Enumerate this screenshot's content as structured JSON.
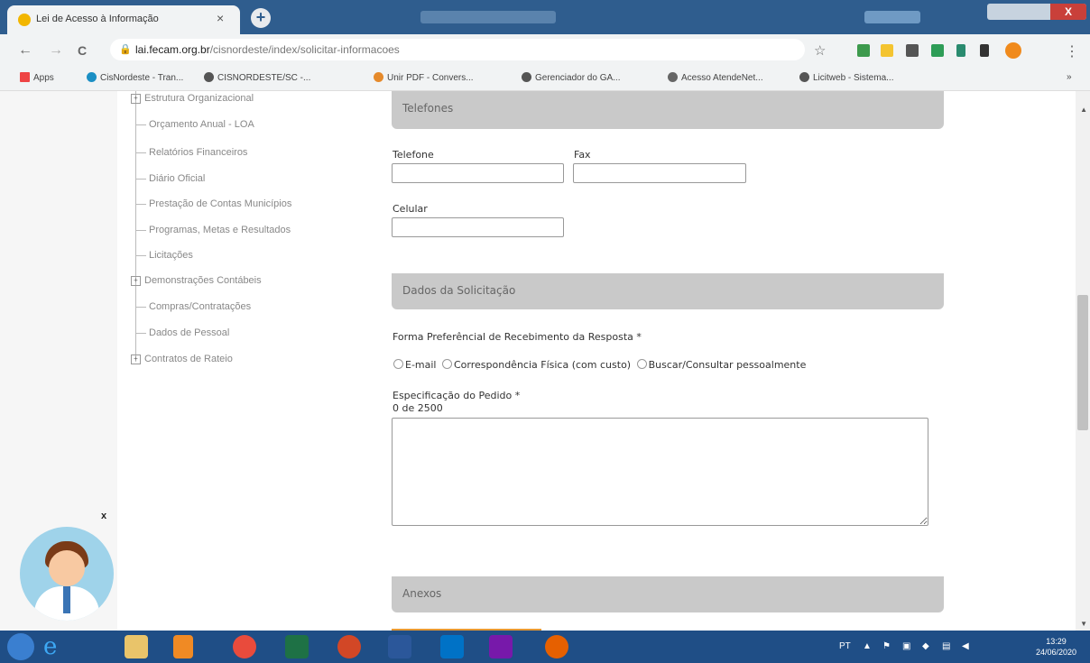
{
  "browser": {
    "tab_title": "Lei de Acesso à Informação",
    "tab_close": "×",
    "new_tab": "+",
    "url_host": "lai.fecam.org.br",
    "url_path": "/cisnordeste/index/solicitar-informacoes",
    "nav": {
      "back": "←",
      "forward": "→",
      "reload": "C",
      "star": "☆",
      "menu": "⋮"
    },
    "bookmarks": [
      "Apps",
      "CisNordeste - Tran...",
      "CISNORDESTE/SC -...",
      "Unir PDF - Convers...",
      "Gerenciador do GA...",
      "Acesso AtendeNet...",
      "Licitweb - Sistema..."
    ],
    "bookmarks_more": "»",
    "window_close": "X"
  },
  "tree": {
    "items": [
      {
        "label": "Estrutura Organizacional",
        "expandable": true
      },
      {
        "label": "Orçamento Anual - LOA",
        "expandable": false
      },
      {
        "label": "Relatórios Financeiros",
        "expandable": false
      },
      {
        "label": "Diário Oficial",
        "expandable": false
      },
      {
        "label": "Prestação de Contas Municípios",
        "expandable": false
      },
      {
        "label": "Programas, Metas e Resultados",
        "expandable": false
      },
      {
        "label": "Licitações",
        "expandable": false
      },
      {
        "label": "Demonstrações Contábeis",
        "expandable": true
      },
      {
        "label": "Compras/Contratações",
        "expandable": false
      },
      {
        "label": "Dados de Pessoal",
        "expandable": false
      },
      {
        "label": "Contratos de Rateio",
        "expandable": true
      }
    ]
  },
  "form": {
    "telefones_header": "Telefones",
    "telefone_label": "Telefone",
    "fax_label": "Fax",
    "celular_label": "Celular",
    "dados_header": "Dados da Solicitação",
    "forma_label": "Forma Preferêncial de Recebimento da Resposta *",
    "radio_email": "E-mail",
    "radio_correspondencia": "Correspondência Física (com custo)",
    "radio_buscar": "Buscar/Consultar pessoalmente",
    "especificacao_label": "Especificação do Pedido *",
    "char_count": "0 de 2500",
    "anexos_header": "Anexos"
  },
  "chat_widget": {
    "close": "x"
  },
  "taskbar": {
    "language": "PT",
    "time": "13:29",
    "date": "24/06/2020"
  }
}
